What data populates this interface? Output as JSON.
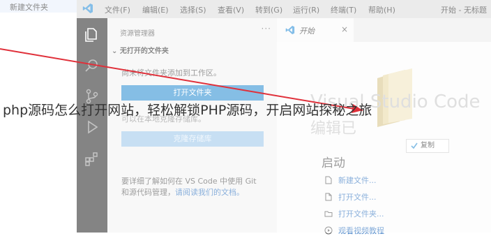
{
  "left_pane": {
    "new_folder_label": "新建文件夹"
  },
  "window": {
    "title": "开始 - 无标题",
    "menu": [
      "文件(F)",
      "编辑(E)",
      "选择(S)",
      "查看(V)",
      "转到(G)",
      "运行(R)",
      "终端(T)",
      "帮助(H)"
    ]
  },
  "activity_bar": {
    "icons": [
      "explorer-icon",
      "search-icon",
      "source-control-icon",
      "run-debug-icon",
      "extensions-icon"
    ]
  },
  "sidebar": {
    "header": "资源管理器",
    "more": "···",
    "section_title": "无打开的文件夹",
    "no_folder_text": "尚未将文件夹添加到工作区。",
    "open_folder_button": "打开文件夹",
    "clone_hint": "可以在本地克隆存储库。",
    "clone_button": "克隆存储库",
    "help_text": "要详细了解如何在 VS Code 中使用 Git 和源代码管理，",
    "help_link": "请阅读我们的文档。"
  },
  "editor": {
    "tab_label": "开始",
    "tab_close": "×",
    "welcome_title": "Visual Studio Code",
    "welcome_subtitle": "编辑已",
    "copy_label": "复制",
    "start_heading": "启动",
    "start_items": [
      "新建文件...",
      "打开文件...",
      "打开文件夹...",
      "观看视频教程"
    ]
  },
  "overlay": {
    "caption": "php源码怎么打开网站，轻松解锁PHP源码，开启网站探秘之旅"
  },
  "colors": {
    "activity_bg": "#2c2c2c",
    "sidebar_bg": "#f3f3f3",
    "button_blue": "#2e90d3",
    "link_blue": "#3476c2",
    "arrow_red": "#e0303a"
  }
}
